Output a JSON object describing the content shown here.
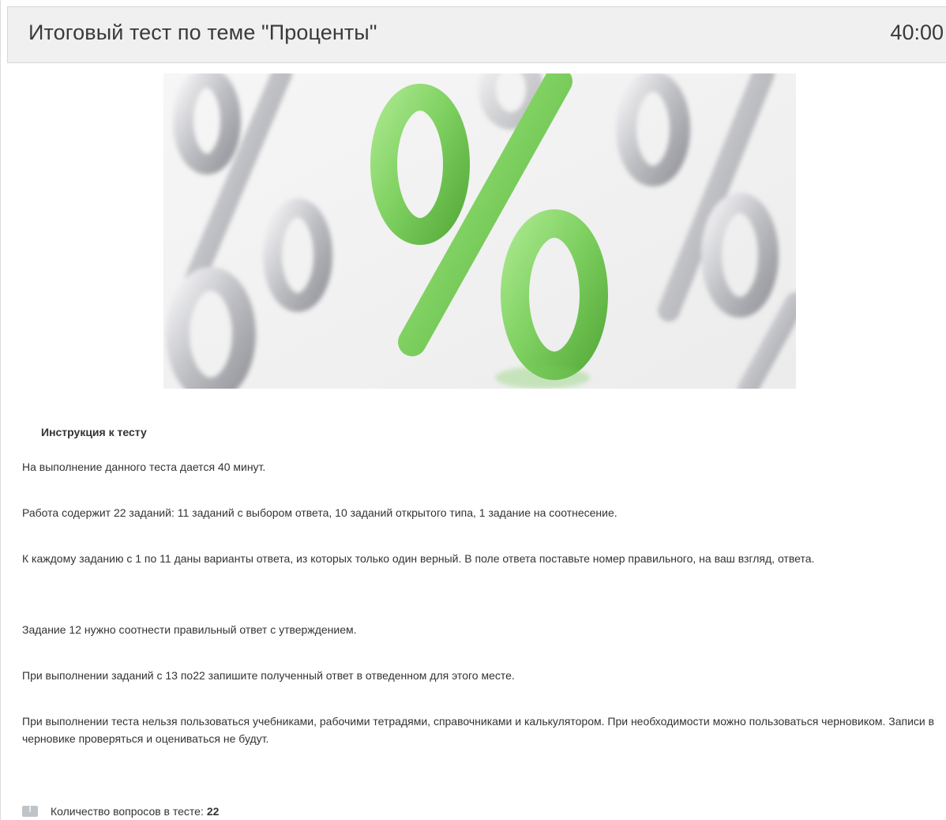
{
  "header": {
    "title": "Итоговый тест по теме \"Проценты\"",
    "timer": "40:00"
  },
  "hero": {
    "image_description_icon": "percent-icon",
    "accent_color": "#7ccf5e"
  },
  "instructions": {
    "title": "Инструкция к тесту",
    "paragraphs": [
      "На выполнение данного теста дается 40 минут.",
      "Работа содержит 22 заданий: 11 заданий с выбором ответа, 10 заданий открытого типа, 1 задание на соотнесение.",
      "К каждому заданию с 1 по 11 даны  варианты ответа, из которых только один верный. В поле ответа поставьте номер правильного, на ваш взгляд, ответа.",
      "Задание 12 нужно соотнести правильный ответ с утверждением.",
      "При выполнении заданий с 13 по22 запишите полученный ответ в отведенном для этого месте.",
      "При выполнении теста нельзя пользоваться учебниками, рабочими тетрадями, справочниками и калькулятором. При необходимости можно пользоваться черновиком. Записи в черновике проверяться и оцениваться не будут."
    ]
  },
  "footer": {
    "question_count_label": "Количество вопросов в тесте:",
    "question_count": "22",
    "icon": "info-icon"
  }
}
